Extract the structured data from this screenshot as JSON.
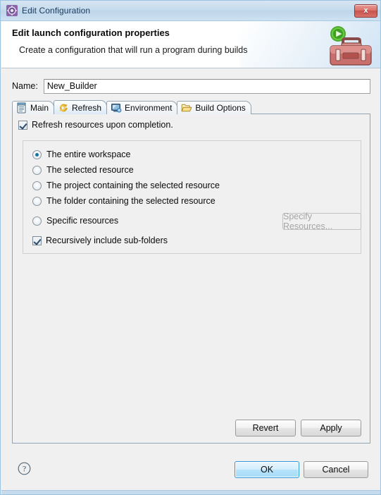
{
  "window": {
    "title": "Edit Configuration",
    "title_icon": "gear-icon",
    "close_label": "x"
  },
  "banner": {
    "title": "Edit launch configuration properties",
    "subtitle": "Create a configuration that will run a program during builds",
    "art_icon": "toolbox-with-run-icon"
  },
  "name_field": {
    "label": "Name:",
    "value": "New_Builder",
    "placeholder": ""
  },
  "tabs": [
    {
      "label": "Main",
      "icon": "document-icon",
      "active": false
    },
    {
      "label": "Refresh",
      "icon": "refresh-icon",
      "active": true
    },
    {
      "label": "Environment",
      "icon": "environment-icon",
      "active": false
    },
    {
      "label": "Build Options",
      "icon": "folder-open-icon",
      "active": false
    }
  ],
  "refresh_tab": {
    "enable_checkbox": {
      "label": "Refresh resources upon completion.",
      "checked": true
    },
    "scope_options": [
      {
        "label": "The entire workspace",
        "selected": true
      },
      {
        "label": "The selected resource",
        "selected": false
      },
      {
        "label": "The project containing the selected resource",
        "selected": false
      },
      {
        "label": "The folder containing the selected resource",
        "selected": false
      },
      {
        "label": "Specific resources",
        "selected": false
      }
    ],
    "specify_button": {
      "label": "Specify Resources...",
      "enabled": false
    },
    "recursive_checkbox": {
      "label": "Recursively include sub-folders",
      "checked": true
    },
    "revert_button": "Revert",
    "apply_button": "Apply"
  },
  "footer": {
    "help_icon": "question-mark-icon",
    "ok_button": "OK",
    "cancel_button": "Cancel"
  },
  "colors": {
    "titlebar": "#c7dcee",
    "accent": "#1a6fa8",
    "close_red": "#c8524b",
    "panel_bg": "#f0f0f0",
    "primary_button_border": "#2f96d8"
  }
}
